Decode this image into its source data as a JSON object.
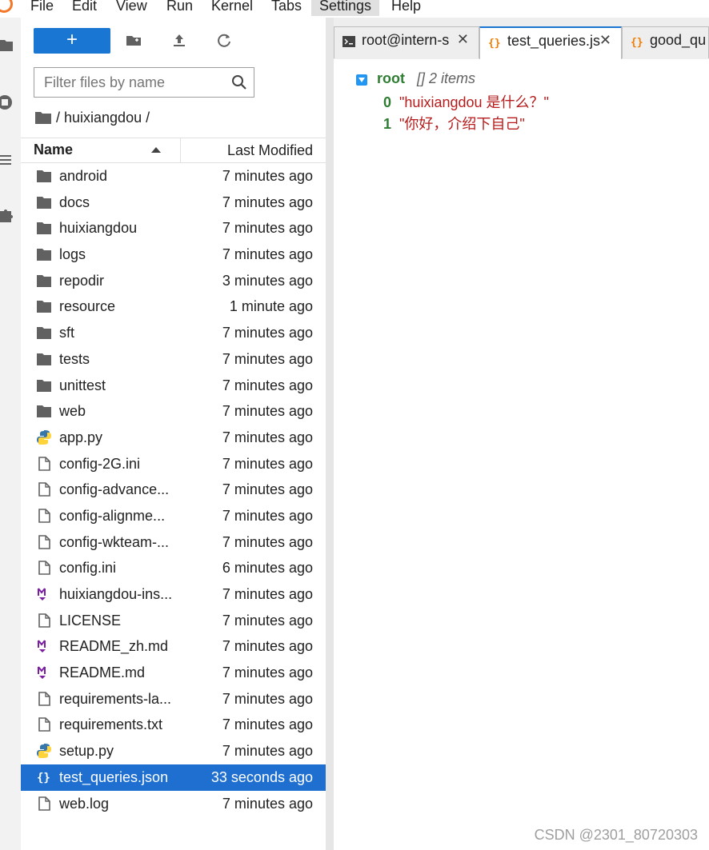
{
  "menu": [
    "File",
    "Edit",
    "View",
    "Run",
    "Kernel",
    "Tabs",
    "Settings",
    "Help"
  ],
  "menu_active": "Settings",
  "toolbar": {
    "new_label": "+"
  },
  "filter": {
    "placeholder": "Filter files by name"
  },
  "breadcrumb": "/ huixiangdou /",
  "columns": {
    "name": "Name",
    "modified": "Last Modified"
  },
  "files": [
    {
      "name": "android",
      "modified": "7 minutes ago",
      "type": "folder"
    },
    {
      "name": "docs",
      "modified": "7 minutes ago",
      "type": "folder"
    },
    {
      "name": "huixiangdou",
      "modified": "7 minutes ago",
      "type": "folder"
    },
    {
      "name": "logs",
      "modified": "7 minutes ago",
      "type": "folder"
    },
    {
      "name": "repodir",
      "modified": "3 minutes ago",
      "type": "folder"
    },
    {
      "name": "resource",
      "modified": "1 minute ago",
      "type": "folder"
    },
    {
      "name": "sft",
      "modified": "7 minutes ago",
      "type": "folder"
    },
    {
      "name": "tests",
      "modified": "7 minutes ago",
      "type": "folder"
    },
    {
      "name": "unittest",
      "modified": "7 minutes ago",
      "type": "folder"
    },
    {
      "name": "web",
      "modified": "7 minutes ago",
      "type": "folder"
    },
    {
      "name": "app.py",
      "modified": "7 minutes ago",
      "type": "python"
    },
    {
      "name": "config-2G.ini",
      "modified": "7 minutes ago",
      "type": "file"
    },
    {
      "name": "config-advance...",
      "modified": "7 minutes ago",
      "type": "file"
    },
    {
      "name": "config-alignme...",
      "modified": "7 minutes ago",
      "type": "file"
    },
    {
      "name": "config-wkteam-...",
      "modified": "7 minutes ago",
      "type": "file"
    },
    {
      "name": "config.ini",
      "modified": "6 minutes ago",
      "type": "file"
    },
    {
      "name": "huixiangdou-ins...",
      "modified": "7 minutes ago",
      "type": "markdown"
    },
    {
      "name": "LICENSE",
      "modified": "7 minutes ago",
      "type": "file"
    },
    {
      "name": "README_zh.md",
      "modified": "7 minutes ago",
      "type": "markdown"
    },
    {
      "name": "README.md",
      "modified": "7 minutes ago",
      "type": "markdown"
    },
    {
      "name": "requirements-la...",
      "modified": "7 minutes ago",
      "type": "file"
    },
    {
      "name": "requirements.txt",
      "modified": "7 minutes ago",
      "type": "file"
    },
    {
      "name": "setup.py",
      "modified": "7 minutes ago",
      "type": "python"
    },
    {
      "name": "test_queries.json",
      "modified": "33 seconds ago",
      "type": "json",
      "selected": true
    },
    {
      "name": "web.log",
      "modified": "7 minutes ago",
      "type": "file"
    }
  ],
  "tabs": [
    {
      "label": "root@intern-s",
      "icon": "terminal-icon"
    },
    {
      "label": "test_queries.js",
      "icon": "json-icon",
      "active": true
    },
    {
      "label": "good_qu",
      "icon": "json-icon"
    }
  ],
  "json_view": {
    "root_key": "root",
    "root_meta": "[]  2 items",
    "items": [
      {
        "index": "0",
        "value": "\"huixiangdou 是什么？\""
      },
      {
        "index": "1",
        "value": "\"你好，介绍下自己\""
      }
    ]
  },
  "watermark": "CSDN @2301_80720303",
  "colors": {
    "accent": "#1976d2",
    "selected_row": "#1e6fd0",
    "json_key": "#2e7d32",
    "json_string": "#b71c1c"
  }
}
